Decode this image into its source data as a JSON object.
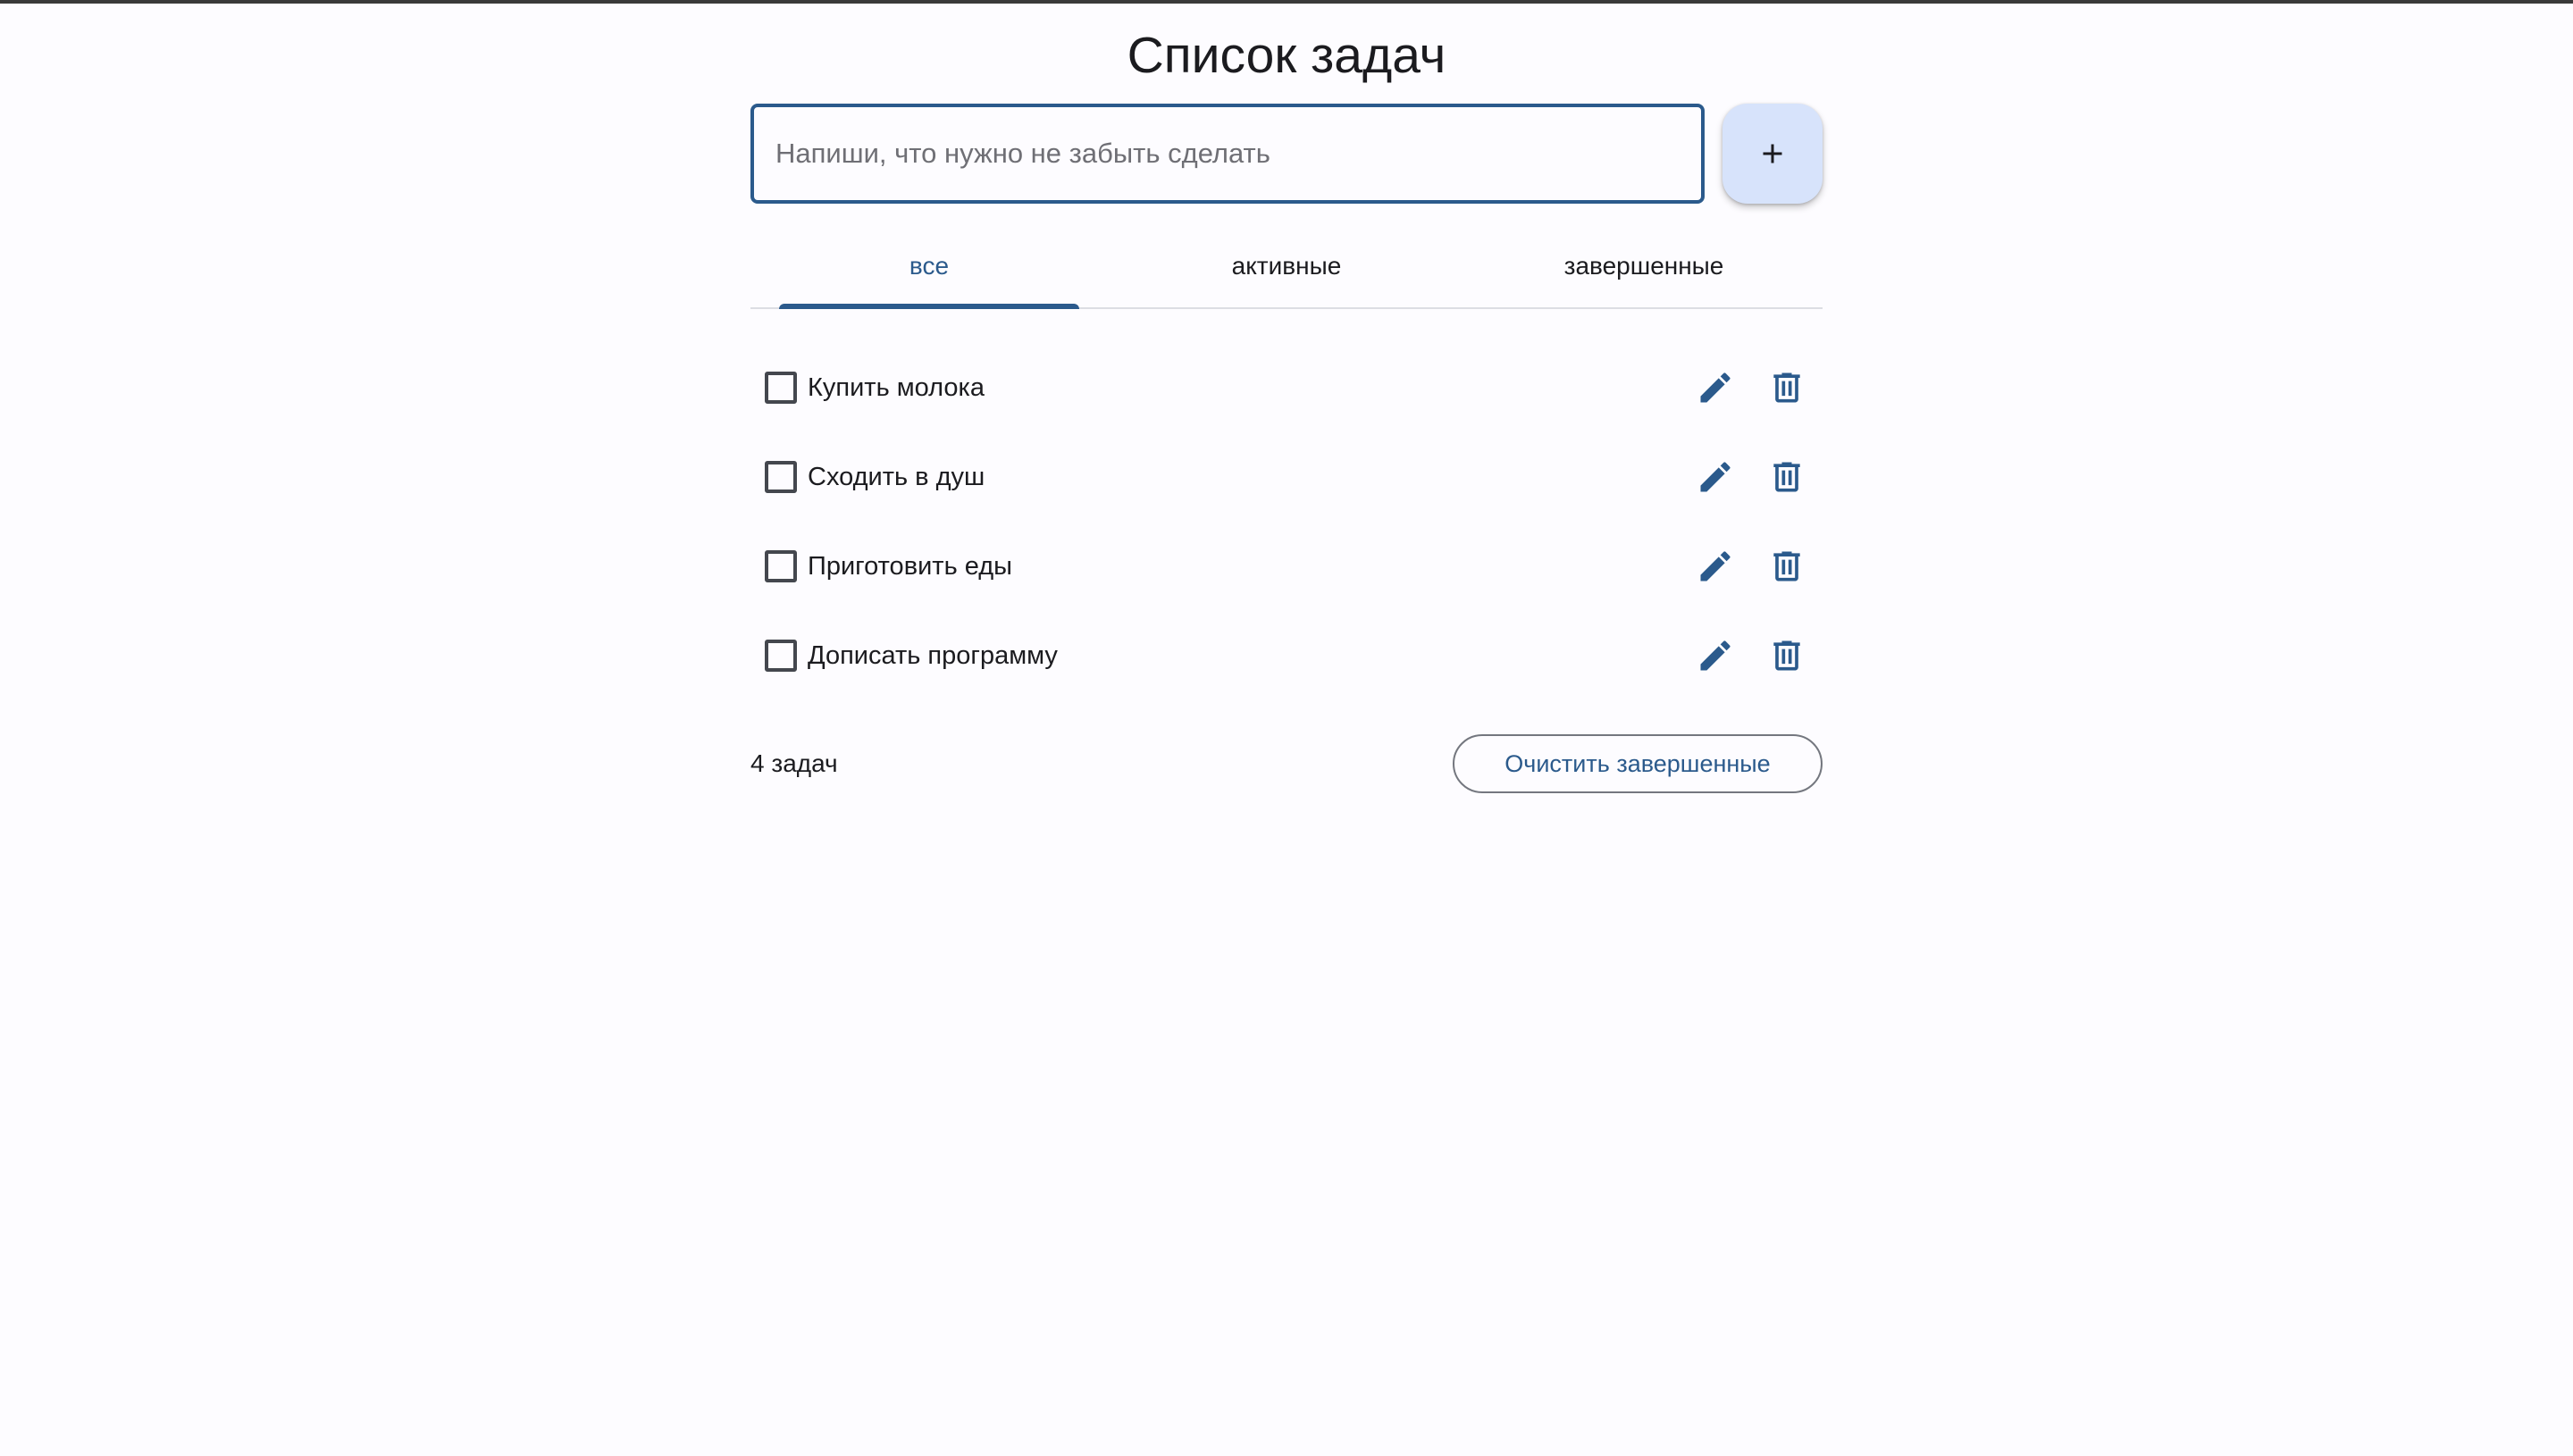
{
  "app": {
    "title": "Список задач"
  },
  "input": {
    "placeholder": "Напиши, что нужно не забыть сделать",
    "value": ""
  },
  "add_button": {
    "icon": "plus-icon"
  },
  "tabs": [
    {
      "label": "все",
      "active": true
    },
    {
      "label": "активные",
      "active": false
    },
    {
      "label": "завершенные",
      "active": false
    }
  ],
  "tasks": [
    {
      "label": "Купить молока",
      "done": false
    },
    {
      "label": "Сходить в душ",
      "done": false
    },
    {
      "label": "Приготовить еды",
      "done": false
    },
    {
      "label": "Дописать программу",
      "done": false
    }
  ],
  "footer": {
    "count_text": "4 задач",
    "clear_label": "Очистить завершенные"
  },
  "colors": {
    "accent": "#2b5a8c",
    "add_button_bg": "#d7e3fb",
    "background": "#fdfcff"
  }
}
